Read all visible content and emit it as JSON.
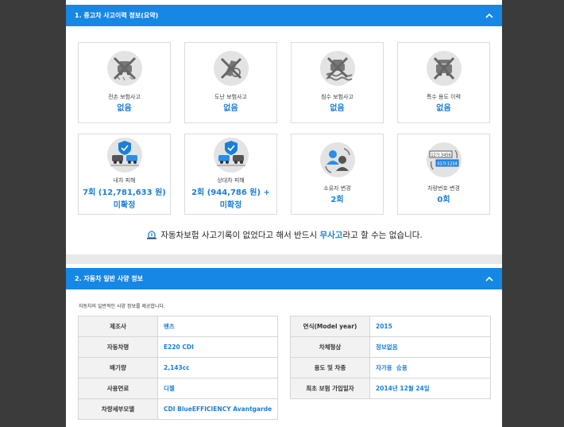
{
  "section1": {
    "title": "1. 중고차 사고이력 정보(요약)",
    "cards": [
      {
        "icon": "car-crash-crossed-icon",
        "label": "전손 보험사고",
        "value": "없음"
      },
      {
        "icon": "car-theft-crossed-icon",
        "label": "도난 보험사고",
        "value": "없음"
      },
      {
        "icon": "flood-car-crossed-icon",
        "label": "침수 보험사고",
        "value": "없음"
      },
      {
        "icon": "special-use-car-crossed-icon",
        "label": "특수 용도 이력",
        "value": "없음"
      },
      {
        "icon": "own-car-damage-icon",
        "label": "내차 피해",
        "value_line1": "7회 (12,781,633 원) +",
        "value_line2": "미확정"
      },
      {
        "icon": "other-car-damage-icon",
        "label": "상대차 피해",
        "value_line1": "2회 (944,786 원) +",
        "value_line2": "미확정"
      },
      {
        "icon": "owner-change-icon",
        "label": "소유자 변경",
        "value": "2회"
      },
      {
        "icon": "plate-change-icon",
        "label": "차량번호 변경",
        "value": "0회",
        "plate_old": "12가 3456",
        "plate_new": "01가 1234"
      }
    ],
    "notice": {
      "pre": "자동차보험 사고기록이 없었다고 해서 반드시 ",
      "highlight": "무사고",
      "post": "라고 할 수는 없습니다."
    }
  },
  "section2": {
    "title": "2. 자동차 일반 사양 정보",
    "description": "자동차의 일반적인 사양 정보를 제공합니다.",
    "left_rows": [
      {
        "key": "제조사",
        "value": "벤츠"
      },
      {
        "key": "자동차명",
        "value": "E220 CDI"
      },
      {
        "key": "배기량",
        "value": "2,143cc"
      },
      {
        "key": "사용연료",
        "value": "디젤"
      },
      {
        "key": "차량세부모델",
        "value": "CDI BlueEFFICIENCY Avantgarde"
      }
    ],
    "right_rows": [
      {
        "key": "연식(Model year)",
        "value": "2015"
      },
      {
        "key": "차체형상",
        "value": "정보없음"
      },
      {
        "key": "용도 및 차종",
        "value": "자가용  승용"
      },
      {
        "key": "최초 보험 가입일자",
        "value": "2014년 12월 24일"
      }
    ]
  },
  "colors": {
    "accent": "#1787e6",
    "value_blue": "#1a7fd8",
    "background": "#3b3b3b"
  }
}
